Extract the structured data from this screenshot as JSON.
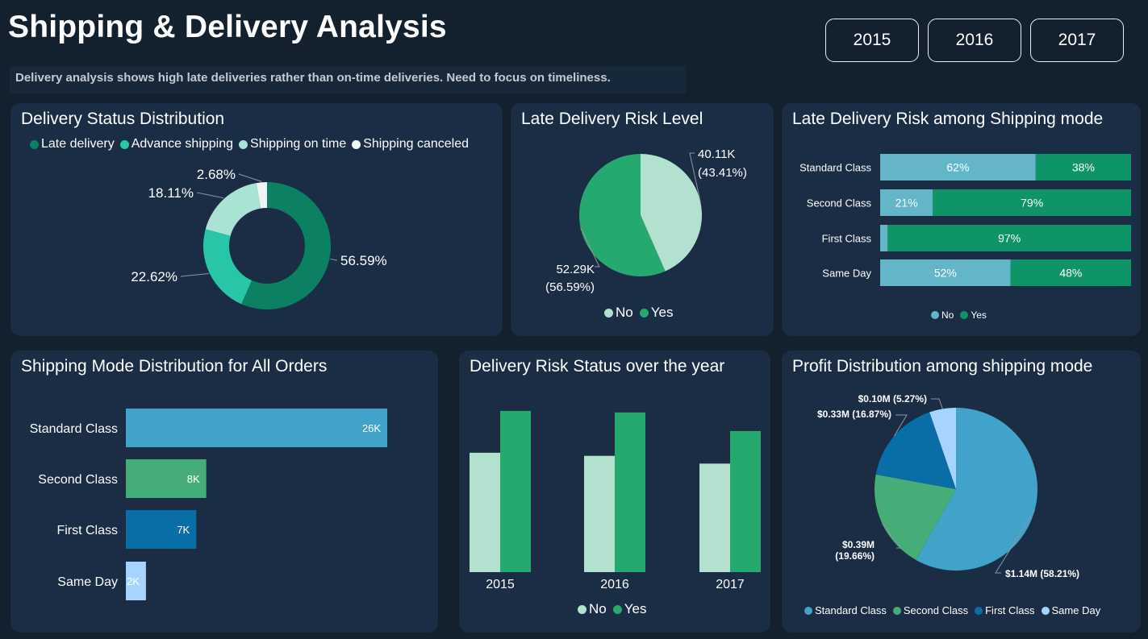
{
  "header": {
    "title": "Shipping & Delivery Analysis",
    "subtitle": "Delivery analysis shows high late deliveries rather than on-time deliveries. Need to focus on timeliness.",
    "years": [
      "2015",
      "2016",
      "2017"
    ]
  },
  "colors": {
    "background": "#13202e",
    "card": "#1a2d44",
    "late_delivery": "#0b8062",
    "advance_shipping": "#26c6a6",
    "shipping_on_time": "#a8e3d4",
    "shipping_canceled": "#eef5f3",
    "no": "#b2e2cf",
    "yes": "#25a96f",
    "mode_no": "#62b6c8",
    "mode_yes": "#0e9466",
    "standard_class": "#41a3c9",
    "second_class": "#46ad78",
    "first_class": "#0a6ea6",
    "same_day": "#a6d4ff"
  },
  "chart_data": [
    {
      "id": "delivery-status",
      "type": "pie",
      "title": "Delivery Status Distribution",
      "donut": true,
      "legend": "top",
      "slices": [
        {
          "name": "Late delivery",
          "value": 56.59,
          "label": "56.59%"
        },
        {
          "name": "Advance shipping",
          "value": 22.62,
          "label": "22.62%"
        },
        {
          "name": "Shipping on time",
          "value": 18.11,
          "label": "18.11%"
        },
        {
          "name": "Shipping canceled",
          "value": 2.68,
          "label": "2.68%"
        }
      ]
    },
    {
      "id": "late-risk",
      "type": "pie",
      "title": "Late Delivery Risk Level",
      "legend": "bottom",
      "slices": [
        {
          "name": "No",
          "value": 40.11,
          "label_value": "40.11K",
          "label_pct": "(43.41%)"
        },
        {
          "name": "Yes",
          "value": 52.29,
          "label_value": "52.29K",
          "label_pct": "(56.59%)"
        }
      ]
    },
    {
      "id": "mode-risk",
      "type": "bar",
      "stacked": "100%",
      "orientation": "horizontal",
      "title": "Late Delivery Risk among Shipping mode",
      "legend": "bottom",
      "categories": [
        "Standard Class",
        "Second Class",
        "First Class",
        "Same Day"
      ],
      "series": [
        {
          "name": "No",
          "values": [
            62,
            21,
            3,
            52
          ],
          "labels": [
            "62%",
            "21%",
            "",
            "52%"
          ]
        },
        {
          "name": "Yes",
          "values": [
            38,
            79,
            97,
            48
          ],
          "labels": [
            "38%",
            "79%",
            "97%",
            "48%"
          ]
        }
      ]
    },
    {
      "id": "mode-orders",
      "type": "bar",
      "orientation": "horizontal",
      "title": "Shipping Mode Distribution for All Orders",
      "categories": [
        "Standard Class",
        "Second Class",
        "First Class",
        "Same Day"
      ],
      "values": [
        26,
        8,
        7,
        2
      ],
      "labels": [
        "26K",
        "8K",
        "7K",
        "2K"
      ],
      "xlim": [
        0,
        26
      ]
    },
    {
      "id": "risk-year",
      "type": "bar",
      "title": "Delivery Risk Status over the year",
      "legend": "bottom",
      "categories": [
        "2015",
        "2016",
        "2017"
      ],
      "series": [
        {
          "name": "No",
          "values": [
            15.4,
            15.0,
            14.0
          ]
        },
        {
          "name": "Yes",
          "values": [
            20.8,
            20.6,
            18.2
          ]
        }
      ],
      "ylim": [
        0,
        21
      ]
    },
    {
      "id": "profit-mode",
      "type": "pie",
      "title": "Profit Distribution among shipping mode",
      "legend": "bottom",
      "slices": [
        {
          "name": "Standard Class",
          "value": 58.21,
          "label": "$1.14M (58.21%)"
        },
        {
          "name": "Second Class",
          "value": 19.66,
          "label_value": "$0.39M",
          "label_pct": "(19.66%)"
        },
        {
          "name": "First Class",
          "value": 16.87,
          "label": "$0.33M (16.87%)"
        },
        {
          "name": "Same Day",
          "value": 5.27,
          "label": "$0.10M (5.27%)"
        }
      ]
    }
  ]
}
